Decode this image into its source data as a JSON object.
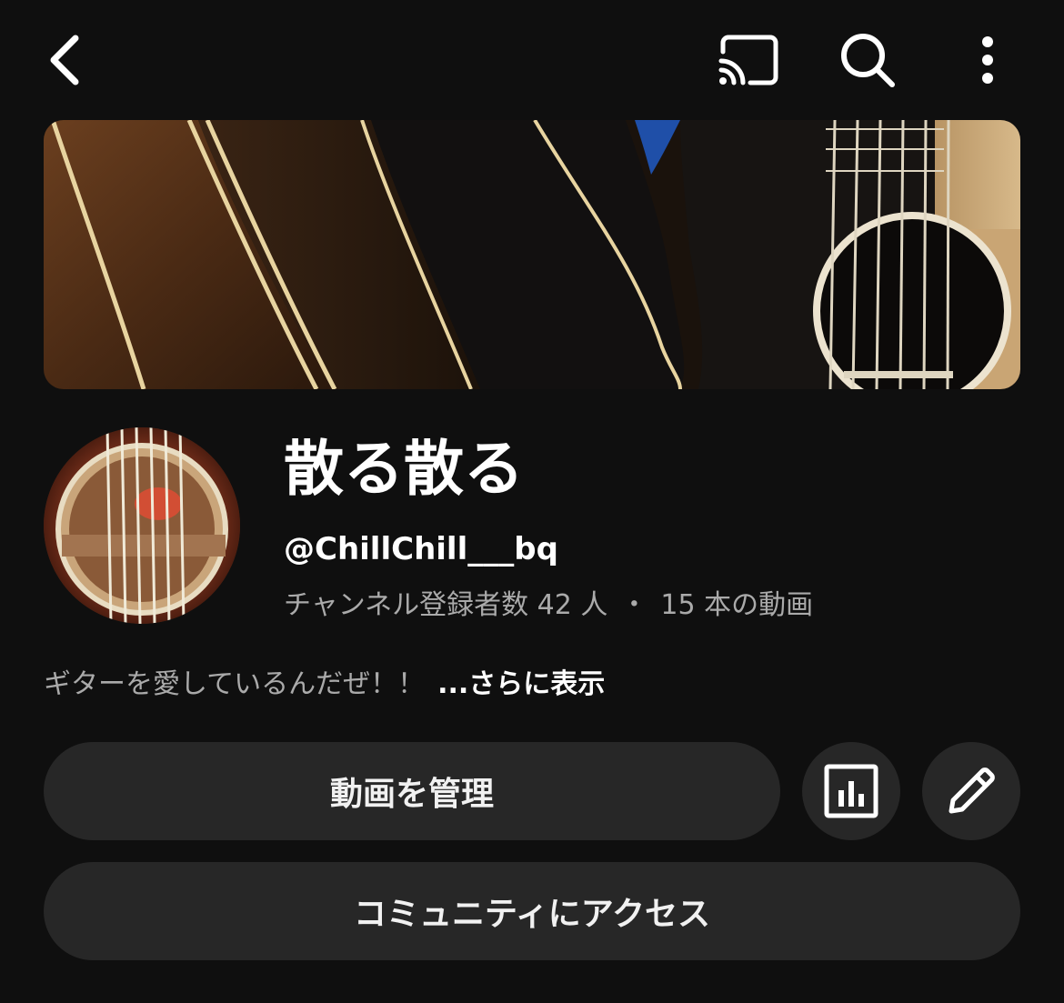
{
  "header": {
    "icons": [
      "back-icon",
      "cast-icon",
      "search-icon",
      "more-vert-icon"
    ]
  },
  "channel": {
    "name": "散る散る",
    "handle": "@ChillChill___bq",
    "subscribers": "チャンネル登録者数 42 人",
    "separator": "・",
    "videos": "15 本の動画",
    "description": "ギターを愛しているんだぜ！！",
    "more_label": "...さらに表示"
  },
  "actions": {
    "manage_videos_label": "動画を管理",
    "analytics_icon": "analytics-icon",
    "edit_icon": "pencil-icon",
    "community_label": "コミュニティにアクセス"
  },
  "colors": {
    "background": "#0f0f0f",
    "button_bg": "#272727",
    "primary_text": "#ffffff",
    "secondary_text": "#aaaaaa"
  }
}
